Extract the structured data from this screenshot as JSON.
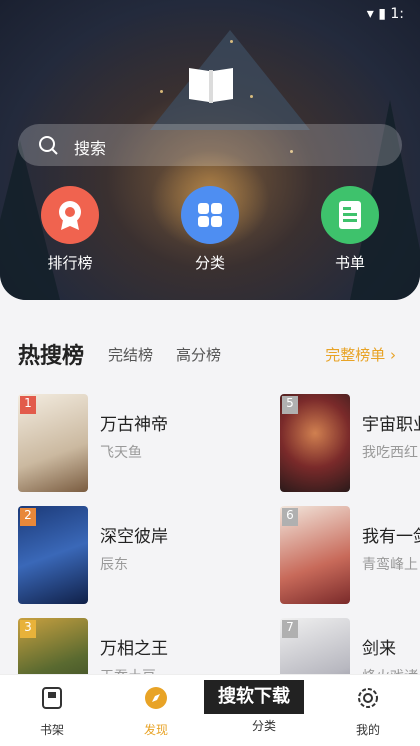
{
  "status": {
    "time": "1:"
  },
  "search": {
    "placeholder": "搜索"
  },
  "features": [
    {
      "label": "排行榜",
      "icon": "ranking-medal-icon",
      "color": "#f0634f"
    },
    {
      "label": "分类",
      "icon": "category-grid-icon",
      "color": "#4e8ef2"
    },
    {
      "label": "书单",
      "icon": "booklist-icon",
      "color": "#3ec26c"
    }
  ],
  "hot": {
    "title": "热搜榜",
    "tabs": [
      "完结榜",
      "高分榜"
    ],
    "more": "完整榜单 ›",
    "books": [
      {
        "rank": "1",
        "title": "万古神帝",
        "author": "飞天鱼"
      },
      {
        "rank": "2",
        "title": "深空彼岸",
        "author": "辰东"
      },
      {
        "rank": "3",
        "title": "万相之王",
        "author": "天蚕土豆"
      },
      {
        "rank": "5",
        "title": "宇宙职业",
        "author": "我吃西红"
      },
      {
        "rank": "6",
        "title": "我有一剑",
        "author": "青鸾峰上"
      },
      {
        "rank": "7",
        "title": "剑来",
        "author": "烽火戏诸"
      }
    ]
  },
  "nav": [
    {
      "label": "书架",
      "icon": "bookshelf-icon"
    },
    {
      "label": "发现",
      "icon": "compass-icon",
      "active": true
    },
    {
      "label": "分类",
      "icon": "category-icon"
    },
    {
      "label": "我的",
      "icon": "settings-gear-icon"
    }
  ],
  "watermark": "搜软下载",
  "colors": {
    "accent": "#e8a326",
    "text": "#222222",
    "muted": "#999999"
  }
}
